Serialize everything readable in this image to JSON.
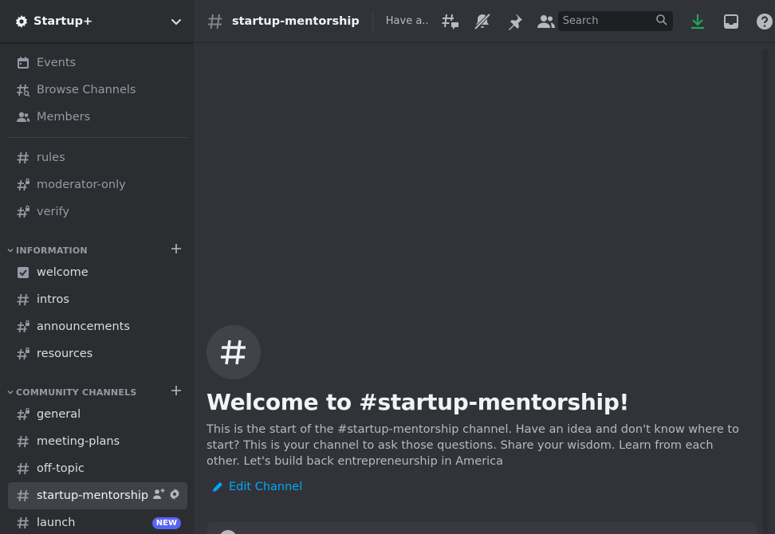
{
  "server": {
    "name": "Startup+",
    "icon": "gear-icon"
  },
  "nav": [
    {
      "label": "Events",
      "icon": "calendar-icon"
    },
    {
      "label": "Browse Channels",
      "icon": "browse-channels-icon"
    },
    {
      "label": "Members",
      "icon": "members-icon"
    }
  ],
  "channels_top": [
    {
      "label": "rules",
      "icon": "hash-icon"
    },
    {
      "label": "moderator-only",
      "icon": "hash-lock-icon"
    },
    {
      "label": "verify",
      "icon": "hash-lock-icon"
    }
  ],
  "categories": [
    {
      "label": "INFORMATION",
      "channels": [
        {
          "label": "welcome",
          "icon": "checkbox-icon"
        },
        {
          "label": "intros",
          "icon": "hash-icon"
        },
        {
          "label": "announcements",
          "icon": "hash-lock-icon"
        },
        {
          "label": "resources",
          "icon": "hash-lock-icon"
        }
      ]
    },
    {
      "label": "COMMUNITY CHANNELS",
      "channels": [
        {
          "label": "general",
          "icon": "hash-lock-icon"
        },
        {
          "label": "meeting-plans",
          "icon": "hash-icon"
        },
        {
          "label": "off-topic",
          "icon": "hash-icon"
        },
        {
          "label": "startup-mentorship",
          "icon": "hash-icon",
          "active": true
        },
        {
          "label": "launch",
          "icon": "hash-icon",
          "badge": "NEW"
        }
      ]
    }
  ],
  "topbar": {
    "channel": "startup-mentorship",
    "topic": "Have a...",
    "search_placeholder": "Search",
    "icons": [
      "threads-icon",
      "mute-bell-icon",
      "pin-icon",
      "member-list-icon"
    ],
    "right_icons": [
      "download-icon",
      "inbox-icon",
      "help-icon"
    ]
  },
  "welcome": {
    "title": "Welcome to #startup-mentorship!",
    "description": "This is the start of the #startup-mentorship channel. Have an idea and don't know where to start? This is your channel to ask those questions. Share your wisdom. Learn from each other. Let's build back entrepreneurship in America",
    "edit_label": "Edit Channel"
  },
  "colors": {
    "accent": "#5865f2",
    "link": "#00a8fc",
    "download": "#23a559",
    "sidebar_bg": "#2b2d31",
    "main_bg": "#313338"
  }
}
